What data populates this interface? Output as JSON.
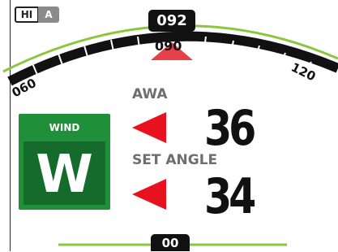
{
  "mode": {
    "hi_label": "HI",
    "auto_label": "A"
  },
  "heading": {
    "value": "092",
    "marker_value": "090"
  },
  "scale": {
    "left_label": "060",
    "right_label": "120"
  },
  "wind_mode": {
    "title": "WIND",
    "letter": "W"
  },
  "awa": {
    "label": "AWA",
    "value": "36",
    "direction": "port"
  },
  "set_angle": {
    "label": "SET ANGLE",
    "value": "34",
    "direction": "port"
  },
  "rudder": {
    "value": "00"
  },
  "colors": {
    "wind_green": "#1f8f3a",
    "wind_green_dark": "#156b2b",
    "scale_green": "#8cc63f",
    "port_red": "#e8121e",
    "label_grey": "#6e6e6e"
  }
}
